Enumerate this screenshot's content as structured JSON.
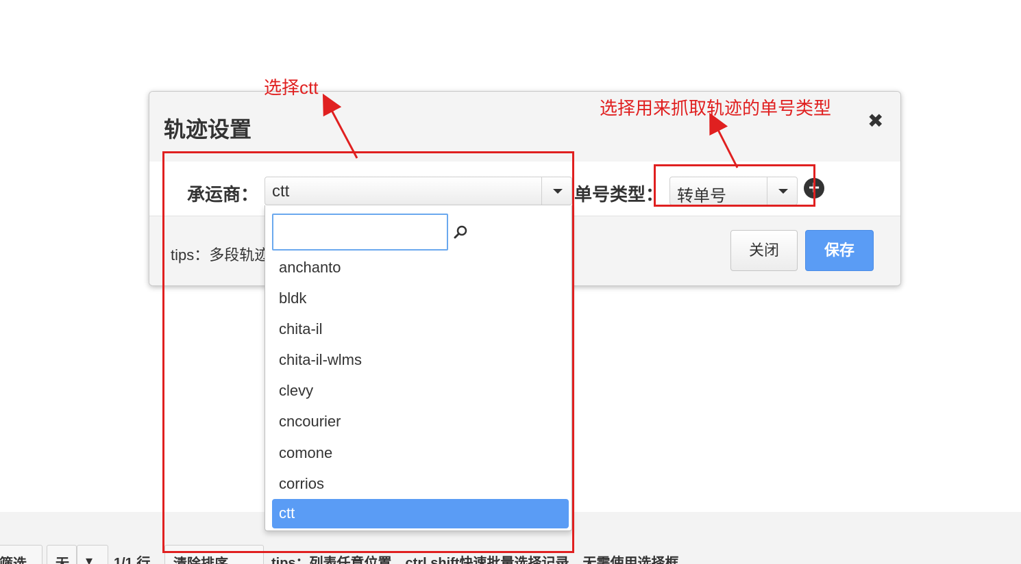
{
  "bottom_toolbar": {
    "filter_label": "筛选",
    "none_label": "无",
    "rows_label": "1/1 行",
    "clear_sort_label": "清除排序",
    "tips": "tips：列表任意位置，ctrl shift快速批量选择记录，无需使用选择框"
  },
  "modal": {
    "title": "轨迹设置",
    "carrier_label": "承运商：",
    "carrier_value": "ctt",
    "number_type_label": "单号类型：",
    "number_type_value": "转单号",
    "tips": "tips：多段轨迹",
    "close_button": "关闭",
    "save_button": "保存"
  },
  "dropdown": {
    "search_placeholder": "",
    "items": [
      "anchanto",
      "bldk",
      "chita-il",
      "chita-il-wlms",
      "clevy",
      "cncourier",
      "comone",
      "corrios",
      "ctt"
    ],
    "selected": "ctt"
  },
  "annotations": {
    "select_carrier": "选择ctt",
    "select_number_type": "选择用来抓取轨迹的单号类型"
  },
  "colors": {
    "accent": "#5a9cf5",
    "annotation": "#e02020"
  }
}
